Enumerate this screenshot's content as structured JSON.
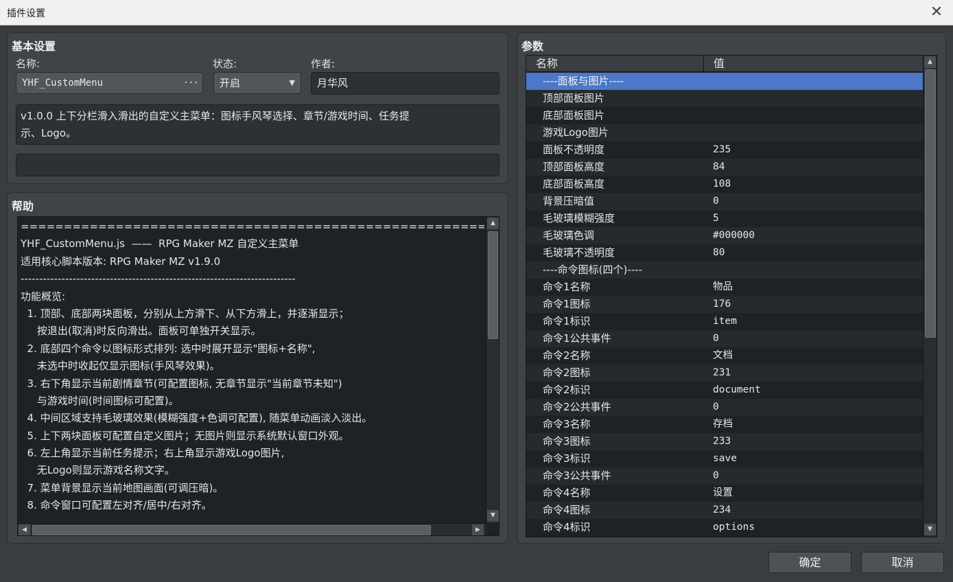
{
  "window": {
    "title": "插件设置",
    "close_glyph": "✕"
  },
  "basic": {
    "title": "基本设置",
    "name_label": "名称:",
    "name_value": "YHF_CustomMenu",
    "status_label": "状态:",
    "status_value": "开启",
    "author_label": "作者:",
    "author_value": "月华风",
    "description_line1": "v1.0.0 上下分栏滑入滑出的自定义主菜单：图标手风琴选择、章节/游戏时间、任务提",
    "description_line2": "示、Logo。",
    "extra_value": ""
  },
  "help": {
    "title": "帮助",
    "lines": [
      "==========================================================================",
      "YHF_CustomMenu.js  ——  RPG Maker MZ 自定义主菜单",
      "适用核心脚本版本: RPG Maker MZ v1.9.0",
      "--------------------------------------------------------------------------",
      "功能概览:",
      "  1. 顶部、底部两块面板，分别从上方滑下、从下方滑上，并逐渐显示；",
      "     按退出(取消)时反向滑出。面板可单独开关显示。",
      "  2. 底部四个命令以图标形式排列: 选中时展开显示\"图标+名称\",",
      "     未选中时收起仅显示图标(手风琴效果)。",
      "  3. 右下角显示当前剧情章节(可配置图标, 无章节显示\"当前章节未知\")",
      "     与游戏时间(时间图标可配置)。",
      "  4. 中间区域支持毛玻璃效果(模糊强度+色调可配置), 随菜单动画淡入淡出。",
      "  5. 上下两块面板可配置自定义图片；无图片则显示系统默认窗口外观。",
      "  6. 左上角显示当前任务提示；右上角显示游戏Logo图片,",
      "     无Logo则显示游戏名称文字。",
      "  7. 菜单背景显示当前地图画面(可调压暗)。",
      "  8. 命令窗口可配置左对齐/居中/右对齐。"
    ]
  },
  "params": {
    "title": "参数",
    "col_name": "名称",
    "col_value": "值",
    "rows": [
      {
        "name": "----面板与图片----",
        "value": ""
      },
      {
        "name": "顶部面板图片",
        "value": ""
      },
      {
        "name": "底部面板图片",
        "value": ""
      },
      {
        "name": "游戏Logo图片",
        "value": ""
      },
      {
        "name": "面板不透明度",
        "value": "235"
      },
      {
        "name": "顶部面板高度",
        "value": "84"
      },
      {
        "name": "底部面板高度",
        "value": "108"
      },
      {
        "name": "背景压暗值",
        "value": "0"
      },
      {
        "name": "毛玻璃模糊强度",
        "value": "5"
      },
      {
        "name": "毛玻璃色调",
        "value": "#000000"
      },
      {
        "name": "毛玻璃不透明度",
        "value": "80"
      },
      {
        "name": "----命令图标(四个)----",
        "value": ""
      },
      {
        "name": "命令1名称",
        "value": "物品"
      },
      {
        "name": "命令1图标",
        "value": "176"
      },
      {
        "name": "命令1标识",
        "value": "item"
      },
      {
        "name": "命令1公共事件",
        "value": "0"
      },
      {
        "name": "命令2名称",
        "value": "文档"
      },
      {
        "name": "命令2图标",
        "value": "231"
      },
      {
        "name": "命令2标识",
        "value": "document"
      },
      {
        "name": "命令2公共事件",
        "value": "0"
      },
      {
        "name": "命令3名称",
        "value": "存档"
      },
      {
        "name": "命令3图标",
        "value": "233"
      },
      {
        "name": "命令3标识",
        "value": "save"
      },
      {
        "name": "命令3公共事件",
        "value": "0"
      },
      {
        "name": "命令4名称",
        "value": "设置"
      },
      {
        "name": "命令4图标",
        "value": "234"
      },
      {
        "name": "命令4标识",
        "value": "options"
      }
    ],
    "selected_index": 0
  },
  "buttons": {
    "ok": "确定",
    "cancel": "取消"
  },
  "icons": {
    "scroll_up": "▲",
    "scroll_down": "▼",
    "scroll_left": "◀",
    "scroll_right": "▶",
    "dropdown": "▼",
    "ellipsis": "···"
  }
}
